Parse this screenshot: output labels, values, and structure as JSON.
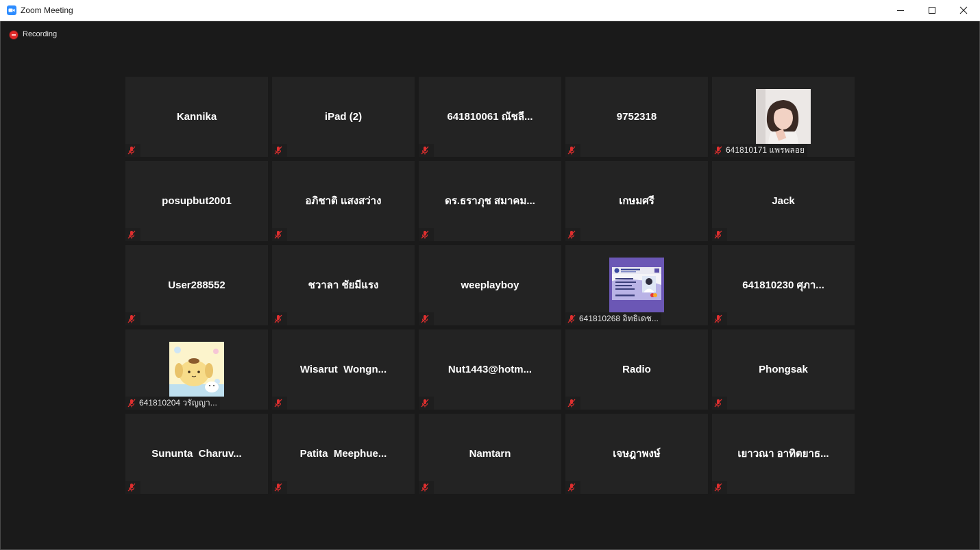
{
  "window": {
    "title": "Zoom Meeting"
  },
  "recording": {
    "label": "Recording"
  },
  "participants": [
    {
      "name": "Kannika"
    },
    {
      "name": "iPad (2)"
    },
    {
      "name": "641810061 ณัชลี..."
    },
    {
      "name": "9752318"
    },
    {
      "label": "641810171 แพรพลอย",
      "photo": "young-woman-portrait"
    },
    {
      "name": "posupbut2001"
    },
    {
      "name": "อภิชาติ แสงสว่าง"
    },
    {
      "name": "ดร.ธราภุช สมาคม..."
    },
    {
      "name": "เกษมศรี"
    },
    {
      "name": "Jack"
    },
    {
      "name": "User288552"
    },
    {
      "name": "ชวาลา ชัยมีแรง"
    },
    {
      "name": "weeplayboy"
    },
    {
      "label": "641810268 อิทธิเดช...",
      "photo": "student-id-card"
    },
    {
      "name": "641810230 ศุภา..."
    },
    {
      "label": "641810204 วรัญญา...",
      "photo": "pompompurin-cartoon"
    },
    {
      "name": "Wisarut  Wongn..."
    },
    {
      "name": "Nut1443@hotm..."
    },
    {
      "name": "Radio"
    },
    {
      "name": "Phongsak"
    },
    {
      "name": "Sununta  Charuv..."
    },
    {
      "name": "Patita  Meephue..."
    },
    {
      "name": "Namtarn"
    },
    {
      "name": "เจษฎาพงษ์"
    },
    {
      "name": "เยาวณา อาทิตยาธ..."
    }
  ],
  "colors": {
    "tile": "#232323",
    "background": "#1a1a1a",
    "mute_icon": "#e02f2f",
    "recording": "#e02828"
  }
}
